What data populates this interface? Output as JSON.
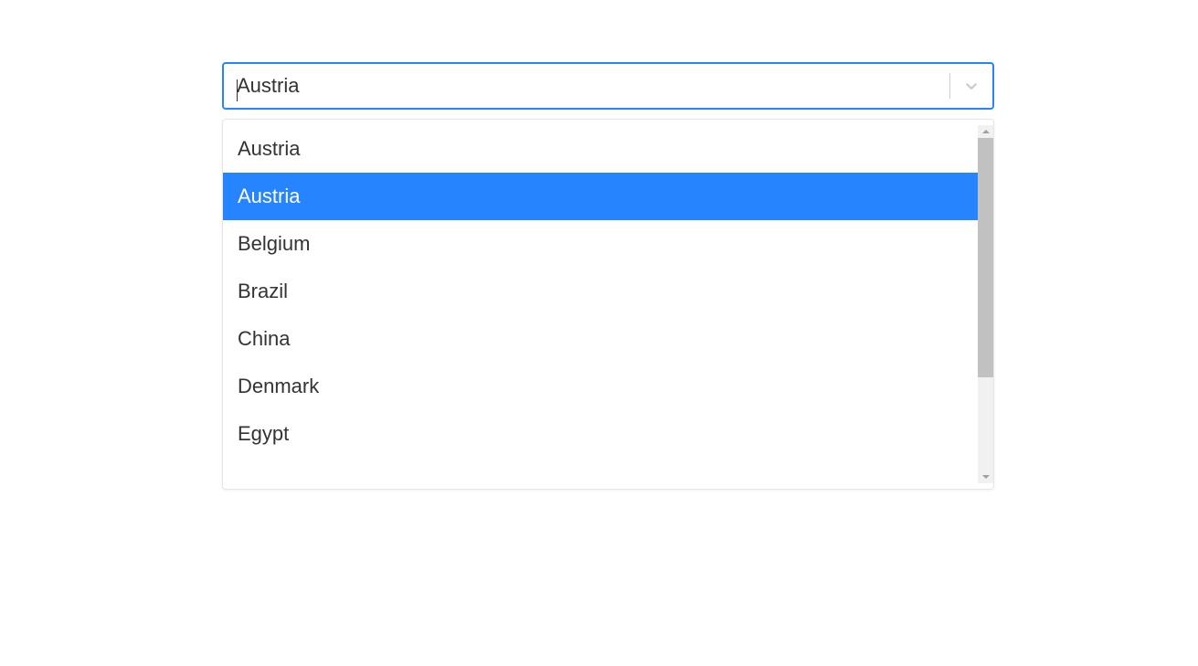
{
  "select": {
    "value": "Austria",
    "highlighted_index": 1,
    "options": [
      "Austria",
      "Austria",
      "Belgium",
      "Brazil",
      "China",
      "Denmark",
      "Egypt"
    ]
  },
  "colors": {
    "accent": "#2684ff",
    "border_gray": "#cccccc",
    "scroll_thumb": "#c1c1c1",
    "scroll_track": "#f1f1f1"
  },
  "scrollbar": {
    "thumb_top_pct": 0,
    "thumb_height_pct": 72
  }
}
